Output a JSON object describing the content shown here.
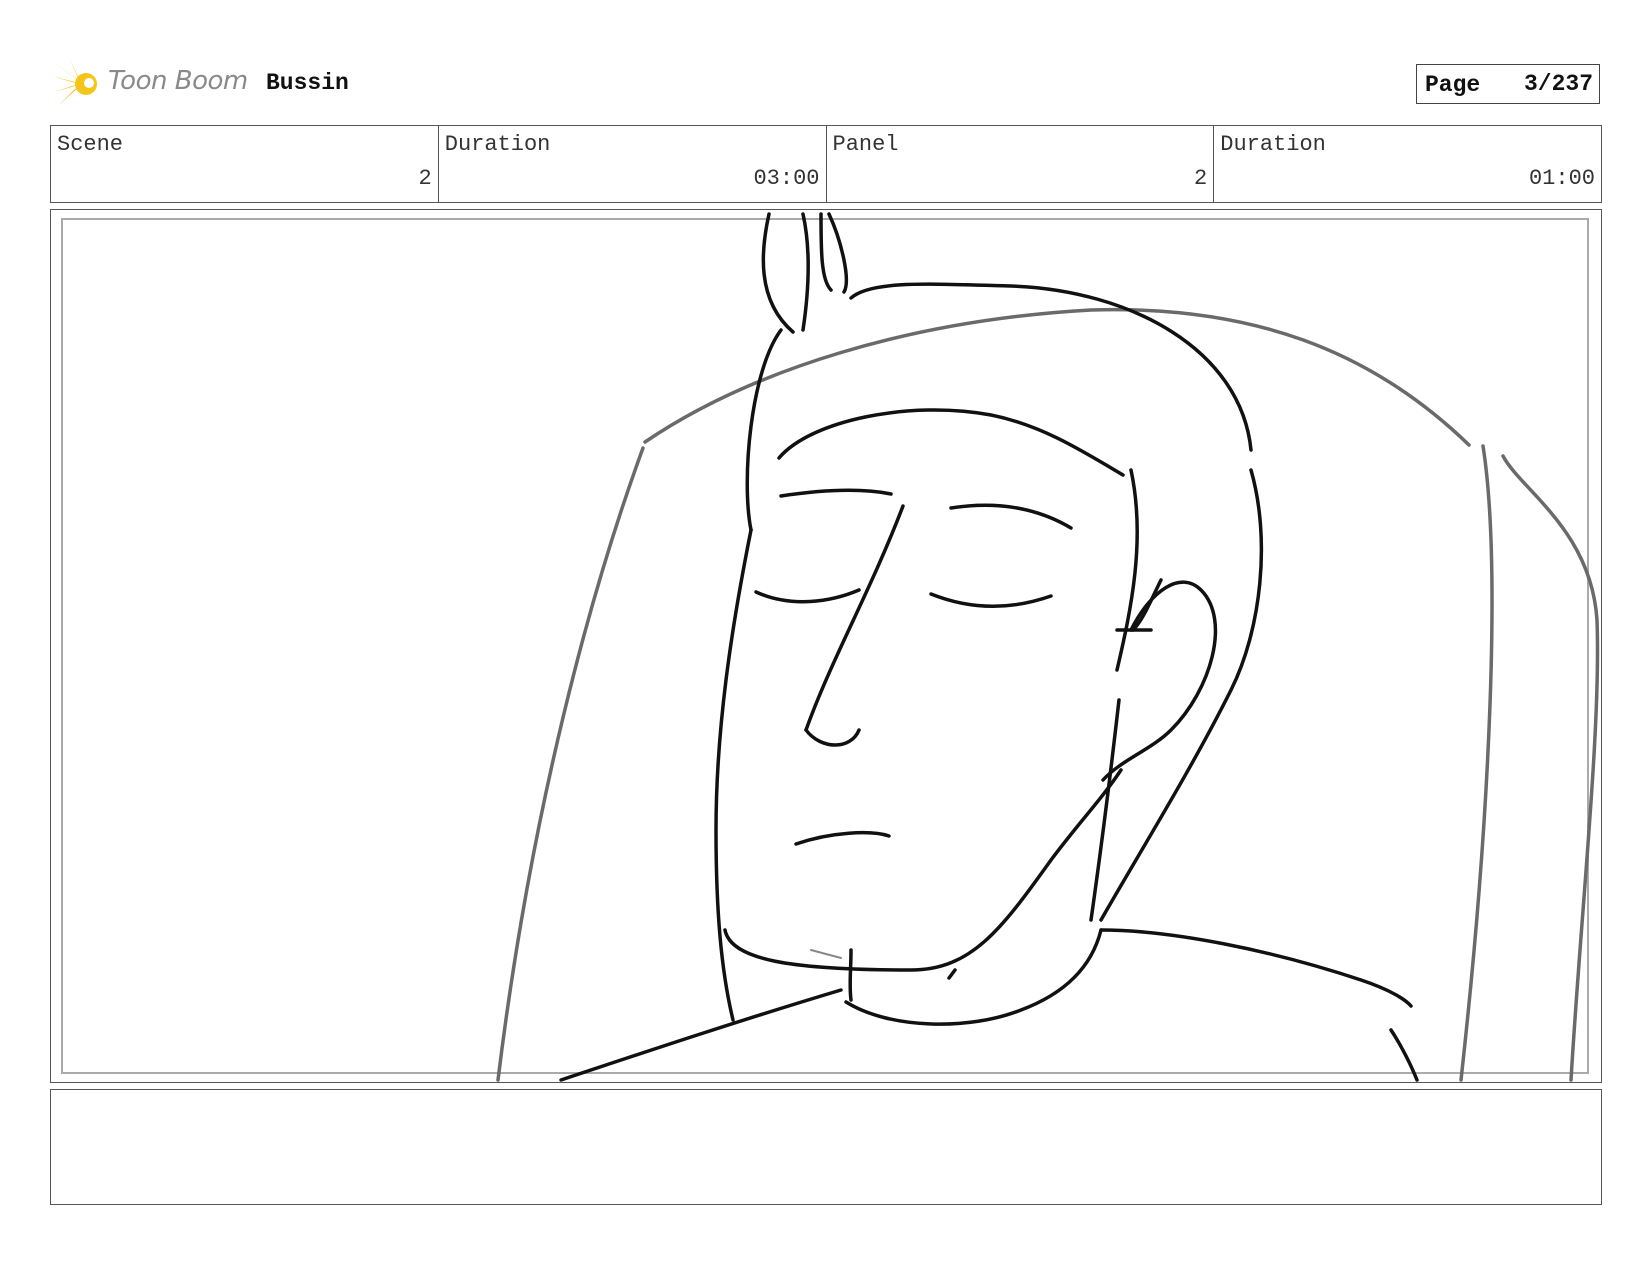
{
  "header": {
    "brand": "Toon Boom",
    "project": "Bussin",
    "page_label": "Page",
    "page_value": "3/237"
  },
  "info": {
    "scene_label": "Scene",
    "scene_value": "2",
    "scene_duration_label": "Duration",
    "scene_duration_value": "03:00",
    "panel_label": "Panel",
    "panel_value": "2",
    "panel_duration_label": "Duration",
    "panel_duration_value": "01:00"
  },
  "panel_image": {
    "description_icon": "sketch-close-up-sleeping-face"
  },
  "notes": {
    "text": ""
  },
  "colors": {
    "logo_yellow": "#f5c518",
    "sketch_black": "#111111",
    "sketch_gray": "#6a6a6a"
  }
}
